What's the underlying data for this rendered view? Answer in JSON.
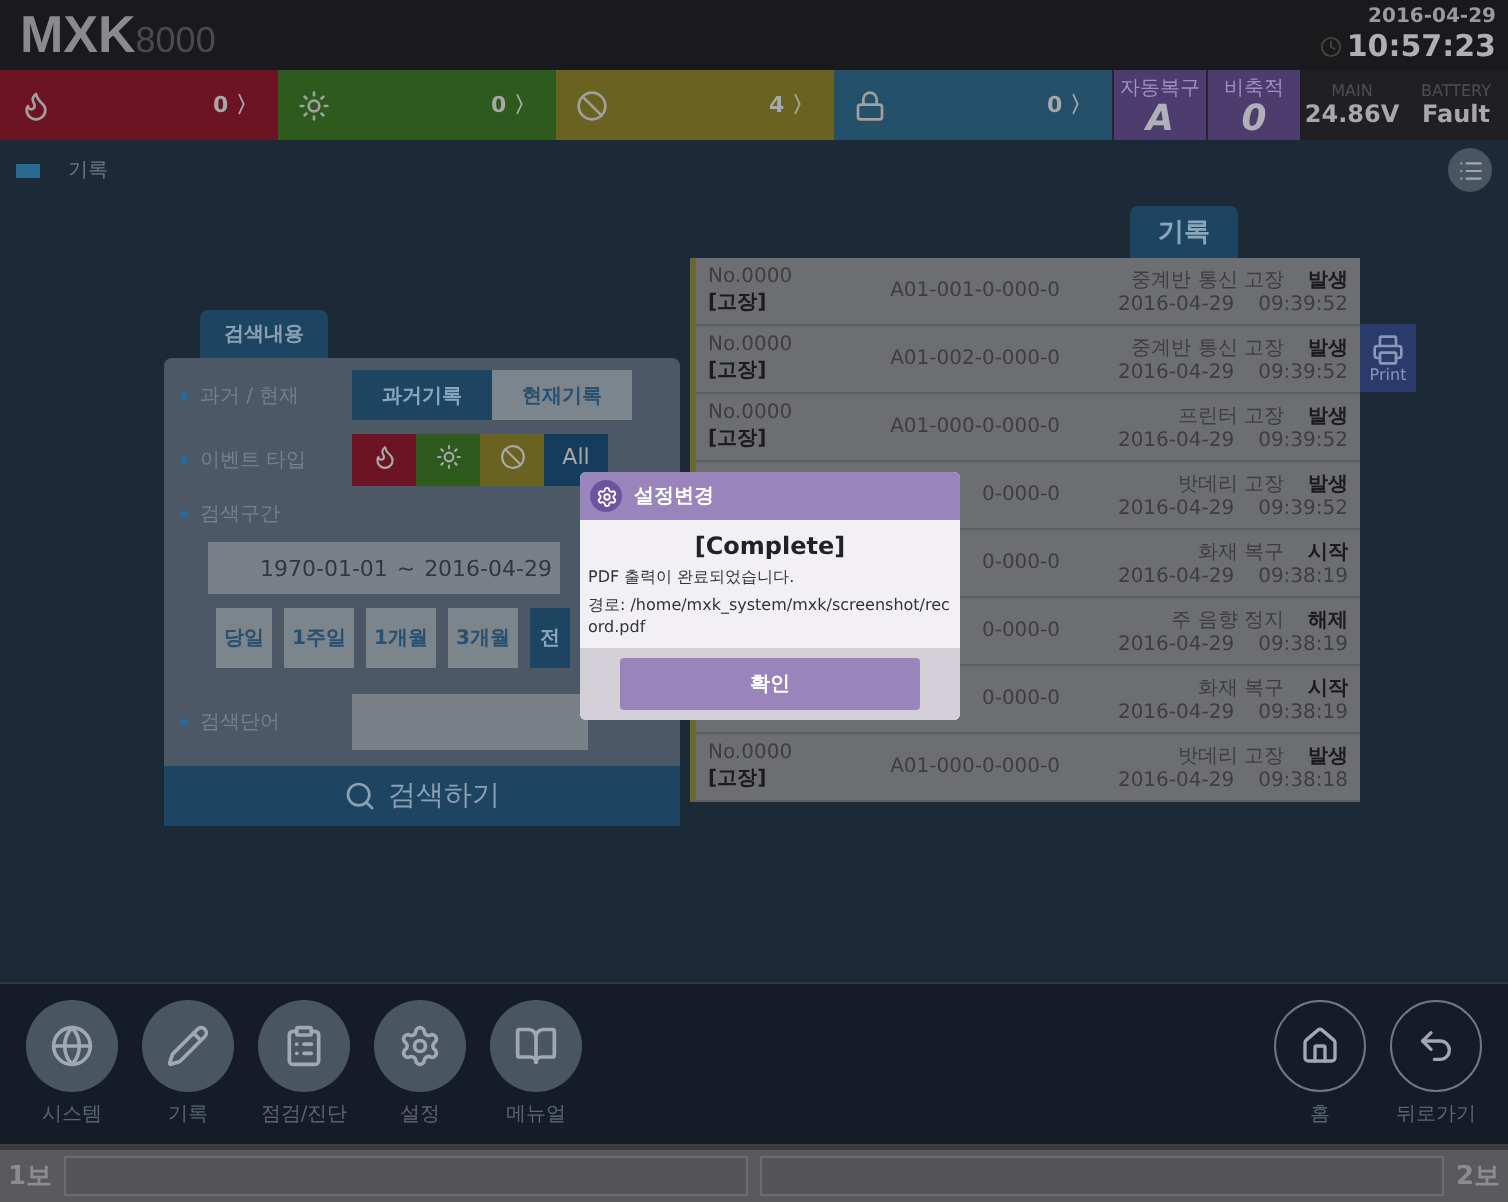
{
  "header": {
    "logo": "MXK",
    "model": "8000",
    "date": "2016-04-29",
    "time": "10:57:23"
  },
  "status_segments": [
    {
      "count": "0",
      "chevron": "〉",
      "color": "#6d1424"
    },
    {
      "count": "0",
      "chevron": "〉",
      "color": "#2f5a1e"
    },
    {
      "count": "4",
      "chevron": "〉",
      "color": "#6a6220"
    },
    {
      "count": "0",
      "chevron": "〉",
      "color": "#24506a"
    }
  ],
  "modes": [
    {
      "label": "자동복구",
      "value": "A"
    },
    {
      "label": "비축적",
      "value": "0"
    }
  ],
  "power": [
    {
      "label": "MAIN",
      "value": "24.86V"
    },
    {
      "label": "BATTERY",
      "value": "Fault"
    }
  ],
  "breadcrumb": "기록",
  "search_panel": {
    "tab": "검색내용",
    "period": {
      "label": "과거 / 현재",
      "options": [
        {
          "label": "과거기록",
          "selected": true
        },
        {
          "label": "현재기록",
          "selected": false
        }
      ]
    },
    "event_type": {
      "label": "이벤트 타입",
      "options": [
        {
          "kind": "icon",
          "color": "#6d1424"
        },
        {
          "kind": "icon",
          "color": "#2f5a1e"
        },
        {
          "kind": "icon",
          "color": "#6a6220"
        },
        {
          "kind": "text",
          "label": "All",
          "color": "#163c5c"
        }
      ]
    },
    "range": {
      "label": "검색구간",
      "from": "1970-01-01",
      "separator": "~",
      "to": "2016-04-29",
      "presets": [
        {
          "label": "당일",
          "selected": false
        },
        {
          "label": "1주일",
          "selected": false
        },
        {
          "label": "1개월",
          "selected": false
        },
        {
          "label": "3개월",
          "selected": false
        },
        {
          "label": "전",
          "selected": true
        }
      ]
    },
    "keyword": {
      "label": "검색단어"
    },
    "search_button": "검색하기"
  },
  "records": {
    "title": "기록",
    "rows": [
      {
        "number": "No.0000",
        "tag": "[고장]",
        "code": "A01-001-0-000-0",
        "event": "중계반 통신 고장",
        "status": "발생",
        "date": "2016-04-29",
        "time": "09:39:52"
      },
      {
        "number": "No.0000",
        "tag": "[고장]",
        "code": "A01-002-0-000-0",
        "event": "중계반 통신 고장",
        "status": "발생",
        "date": "2016-04-29",
        "time": "09:39:52"
      },
      {
        "number": "No.0000",
        "tag": "[고장]",
        "code": "A01-000-0-000-0",
        "event": "프린터 고장",
        "status": "발생",
        "date": "2016-04-29",
        "time": "09:39:52"
      },
      {
        "code": "0-000-0",
        "event": "밧데리 고장",
        "status": "발생",
        "date": "2016-04-29",
        "time": "09:39:52"
      },
      {
        "code": "0-000-0",
        "event": "화재 복구",
        "status": "시작",
        "date": "2016-04-29",
        "time": "09:38:19"
      },
      {
        "code": "0-000-0",
        "event": "주 음향 정지",
        "status": "해제",
        "date": "2016-04-29",
        "time": "09:38:19"
      },
      {
        "code": "0-000-0",
        "event": "화재 복구",
        "status": "시작",
        "date": "2016-04-29",
        "time": "09:38:19"
      },
      {
        "number": "No.0000",
        "tag": "[고장]",
        "code": "A01-000-0-000-0",
        "event": "밧데리 고장",
        "status": "발생",
        "date": "2016-04-29",
        "time": "09:38:18"
      }
    ]
  },
  "print_button": "Print",
  "dialog": {
    "title": "설정변경",
    "heading": "[Complete]",
    "message": [
      "PDF 출력이 완료되었습니다.",
      "경로: /home/mxk_system/mxk/screenshot/record.pdf"
    ],
    "button": "확인"
  },
  "nav": [
    {
      "label": "시스템"
    },
    {
      "label": "기록"
    },
    {
      "label": "점검/진단"
    },
    {
      "label": "설정"
    },
    {
      "label": "메뉴얼"
    }
  ],
  "nav_right": [
    {
      "label": "홈"
    },
    {
      "label": "뒤로가기"
    }
  ],
  "footer": {
    "left": "1보",
    "right": "2보"
  }
}
